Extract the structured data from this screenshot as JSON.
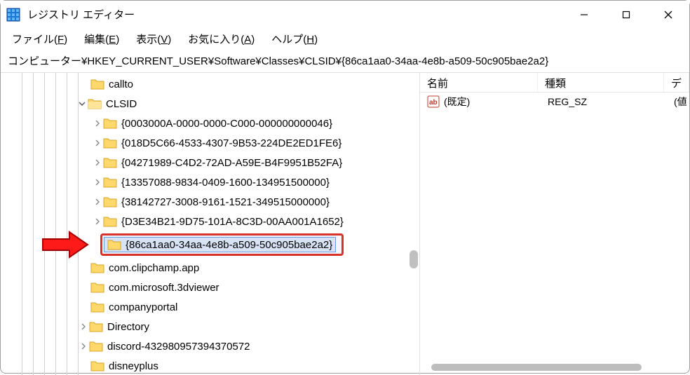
{
  "titlebar": {
    "title": "レジストリ エディター"
  },
  "menu": {
    "file": "ファイル(F)",
    "edit": "編集(E)",
    "view": "表示(V)",
    "favorites": "お気に入り(A)",
    "help": "ヘルプ(H)"
  },
  "address": "コンピューター¥HKEY_CURRENT_USER¥Software¥Classes¥CLSID¥{86ca1aa0-34aa-4e8b-a509-50c905bae2a2}",
  "tree": {
    "callto": "callto",
    "clsid": "CLSID",
    "items": [
      "{0003000A-0000-0000-C000-000000000046}",
      "{018D5C66-4533-4307-9B53-224DE2ED1FE6}",
      "{04271989-C4D2-72AD-A59E-B4F9951B52FA}",
      "{13357088-9834-0409-1600-134951500000}",
      "{38142727-3008-9161-1521-349515000000}",
      "{D3E34B21-9D75-101A-8C3D-00AA001A1652}",
      "{86ca1aa0-34aa-4e8b-a509-50c905bae2a2}"
    ],
    "after": [
      "com.clipchamp.app",
      "com.microsoft.3dviewer",
      "companyportal",
      "Directory",
      "discord-432980957394370572",
      "disneyplus"
    ]
  },
  "list": {
    "headers": {
      "name": "名前",
      "type": "種類",
      "data": "デ"
    },
    "rows": [
      {
        "name": "(既定)",
        "type": "REG_SZ",
        "data": "(値"
      }
    ]
  }
}
